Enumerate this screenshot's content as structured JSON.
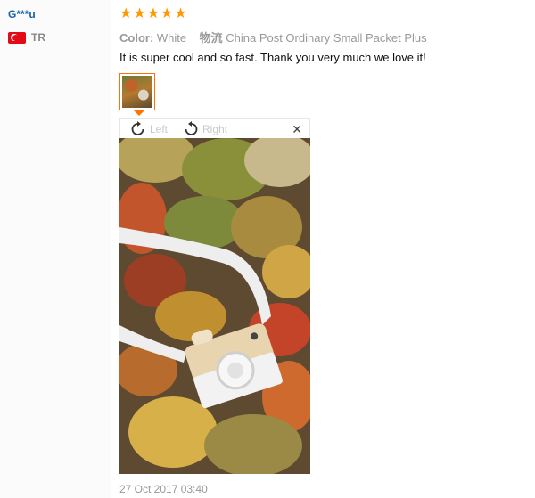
{
  "review": {
    "user": "G***u",
    "country_code": "TR",
    "rating": 5,
    "color_label": "Color:",
    "color_value": "White",
    "shipping_label": "物流",
    "shipping_value": "China Post Ordinary Small Packet Plus",
    "text": "It is super cool and so fast. Thank you very much we love it!",
    "date": "27 Oct 2017 03:40"
  },
  "viewer": {
    "rotate_left_label": "Left",
    "rotate_right_label": "Right",
    "close_symbol": "✕"
  },
  "colors": {
    "star": "#ff9900",
    "accent": "#ff7300",
    "username": "#1a5fa8"
  }
}
